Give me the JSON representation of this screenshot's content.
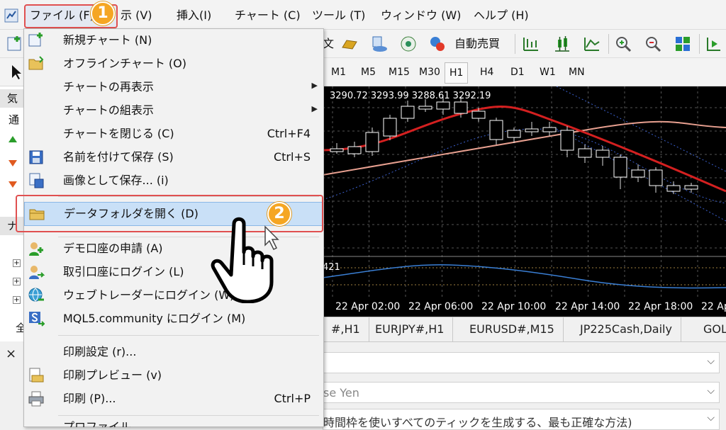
{
  "menubar": {
    "items": [
      "ファイル (F)",
      "示 (V)",
      "挿入(I)",
      "チャート (C)",
      "ツール (T)",
      "ウィンドウ (W)",
      "ヘルプ (H)"
    ]
  },
  "badges": {
    "step1": "1",
    "step2": "2"
  },
  "toolbar": {
    "auto_trade_label": "自動売買",
    "partial_label": "文"
  },
  "timeframes": [
    "M1",
    "M5",
    "M15",
    "M30",
    "H1",
    "H4",
    "D1",
    "W1",
    "MN"
  ],
  "active_timeframe": "H1",
  "left_panel": {
    "market_watch_label": "気",
    "market_tab_label": "通",
    "navigator_label": "ナ",
    "all_label": "全"
  },
  "chart": {
    "ohlc": "3290.72 3293.99 3288.61 3292.19",
    "indicator_value": "421",
    "time_labels": [
      "22 Apr 02:00",
      "22 Apr 06:00",
      "22 Apr 10:00",
      "22 Apr 14:00",
      "22 Apr 18:00",
      "22 Ap"
    ]
  },
  "chart_tabs": [
    "#,H1",
    "EURJPY#,H1",
    "EURUSD#,M15",
    "JP225Cash,Daily",
    "GOL"
  ],
  "tester": {
    "close_symbol": "×",
    "currency_text": "se Yen",
    "model_text": "時間枠を使いすべてのティックを生成する、最も正確な方法)"
  },
  "file_menu": {
    "items": [
      {
        "label": "新規チャート (N)",
        "shortcut": "",
        "submenu": false,
        "icon": "new-chart-icon"
      },
      {
        "label": "オフラインチャート (O)",
        "shortcut": "",
        "submenu": false,
        "icon": "folder-open-icon"
      },
      {
        "label": "チャートの再表示",
        "shortcut": "",
        "submenu": true,
        "icon": ""
      },
      {
        "label": "チャートの組表示",
        "shortcut": "",
        "submenu": true,
        "icon": ""
      },
      {
        "label": "チャートを閉じる (C)",
        "shortcut": "Ctrl+F4",
        "submenu": false,
        "icon": ""
      },
      {
        "label": "名前を付けて保存 (S)",
        "shortcut": "Ctrl+S",
        "submenu": false,
        "icon": "save-icon"
      },
      {
        "label": "画像として保存... (i)",
        "shortcut": "",
        "submenu": false,
        "icon": "save-image-icon"
      },
      {
        "label": "データフォルダを開く (D)",
        "shortcut": "",
        "submenu": false,
        "icon": "folder-icon"
      },
      {
        "label": "デモ口座の申請 (A)",
        "shortcut": "",
        "submenu": false,
        "icon": "demo-account-icon"
      },
      {
        "label": "取引口座にログイン (L)",
        "shortcut": "",
        "submenu": false,
        "icon": "login-icon"
      },
      {
        "label": "ウェブトレーダーにログイン (W)",
        "shortcut": "",
        "submenu": false,
        "icon": "web-trader-icon"
      },
      {
        "label": "MQL5.community にログイン (M)",
        "shortcut": "",
        "submenu": false,
        "icon": "mql5-icon"
      },
      {
        "label": "印刷設定 (r)...",
        "shortcut": "",
        "submenu": false,
        "icon": ""
      },
      {
        "label": "印刷プレビュー (v)",
        "shortcut": "",
        "submenu": false,
        "icon": "print-preview-icon"
      },
      {
        "label": "印刷 (P)...",
        "shortcut": "Ctrl+P",
        "submenu": false,
        "icon": "print-icon"
      },
      {
        "label": "プロファイル...",
        "shortcut": "",
        "submenu": false,
        "icon": ""
      }
    ]
  },
  "colors": {
    "highlight_box": "#e05050",
    "badge": "#f5a623",
    "bull_candle": "#ffffff",
    "ma_red": "#d42020",
    "ma_salmon": "#e8a090",
    "channel_blue": "#3a5fcd"
  }
}
